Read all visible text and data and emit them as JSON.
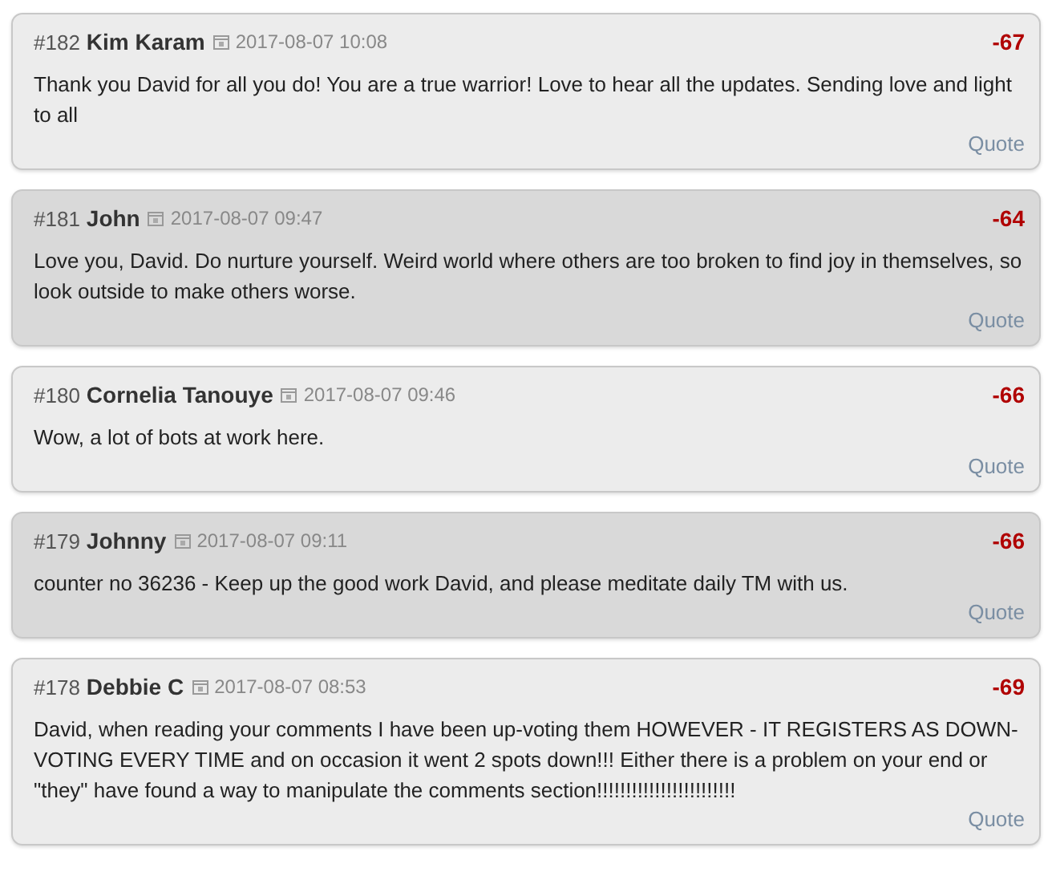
{
  "comments": [
    {
      "number": "#182",
      "author": "Kim Karam",
      "date": "2017-08-07 10:08",
      "score": "-67",
      "text": "Thank you David for all you do! You are a true warrior! Love to hear all the updates. Sending love and light to all",
      "quote": "Quote"
    },
    {
      "number": "#181",
      "author": "John",
      "date": "2017-08-07 09:47",
      "score": "-64",
      "text": "Love you, David. Do nurture yourself. Weird world where others are too broken to find joy in themselves, so look outside to make others worse.",
      "quote": "Quote"
    },
    {
      "number": "#180",
      "author": "Cornelia Tanouye",
      "date": "2017-08-07 09:46",
      "score": "-66",
      "text": "Wow, a lot of bots at work here.",
      "quote": "Quote"
    },
    {
      "number": "#179",
      "author": "Johnny",
      "date": "2017-08-07 09:11",
      "score": "-66",
      "text": "counter no 36236 - Keep up the good work David, and please meditate daily TM with us.",
      "quote": "Quote"
    },
    {
      "number": "#178",
      "author": "Debbie C",
      "date": "2017-08-07 08:53",
      "score": "-69",
      "text": "David, when reading your comments I have been up-voting them HOWEVER - IT REGISTERS AS DOWN-VOTING EVERY TIME and on occasion it went 2 spots down!!! Either there is a problem on your end or \"they\" have found a way to manipulate the comments section!!!!!!!!!!!!!!!!!!!!!!!!",
      "quote": "Quote"
    }
  ]
}
